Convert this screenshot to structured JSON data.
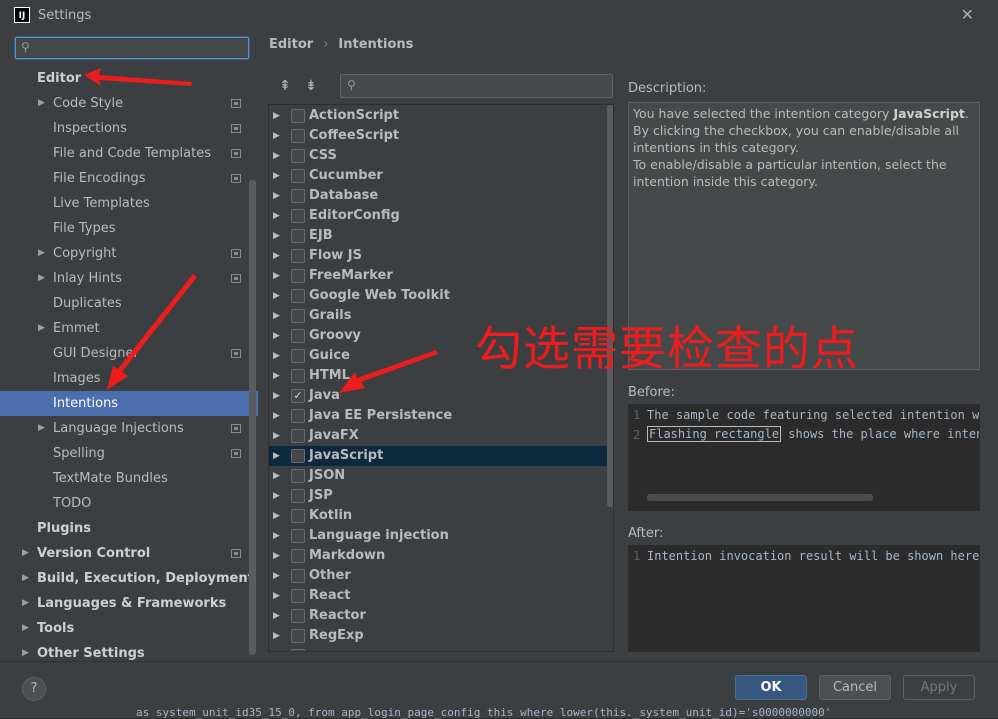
{
  "window": {
    "title": "Settings",
    "app_icon": "intellij-icon"
  },
  "sidebar": {
    "search_placeholder": "",
    "items": [
      {
        "label": "Editor",
        "level": 0,
        "bold": true,
        "arrow": false,
        "proj": false
      },
      {
        "label": "Code Style",
        "level": 1,
        "arrow": true,
        "proj": true
      },
      {
        "label": "Inspections",
        "level": 1,
        "arrow": false,
        "proj": true
      },
      {
        "label": "File and Code Templates",
        "level": 1,
        "arrow": false,
        "proj": true
      },
      {
        "label": "File Encodings",
        "level": 1,
        "arrow": false,
        "proj": true
      },
      {
        "label": "Live Templates",
        "level": 1,
        "arrow": false,
        "proj": false
      },
      {
        "label": "File Types",
        "level": 1,
        "arrow": false,
        "proj": false
      },
      {
        "label": "Copyright",
        "level": 1,
        "arrow": true,
        "proj": true
      },
      {
        "label": "Inlay Hints",
        "level": 1,
        "arrow": true,
        "proj": true
      },
      {
        "label": "Duplicates",
        "level": 1,
        "arrow": false,
        "proj": false
      },
      {
        "label": "Emmet",
        "level": 1,
        "arrow": true,
        "proj": false
      },
      {
        "label": "GUI Designer",
        "level": 1,
        "arrow": false,
        "proj": true
      },
      {
        "label": "Images",
        "level": 1,
        "arrow": false,
        "proj": false
      },
      {
        "label": "Intentions",
        "level": 1,
        "arrow": false,
        "proj": false,
        "selected": true
      },
      {
        "label": "Language Injections",
        "level": 1,
        "arrow": true,
        "proj": true
      },
      {
        "label": "Spelling",
        "level": 1,
        "arrow": false,
        "proj": true
      },
      {
        "label": "TextMate Bundles",
        "level": 1,
        "arrow": false,
        "proj": false
      },
      {
        "label": "TODO",
        "level": 1,
        "arrow": false,
        "proj": false
      },
      {
        "label": "Plugins",
        "level": 0,
        "bold": true,
        "arrow": false,
        "proj": false
      },
      {
        "label": "Version Control",
        "level": 0,
        "bold": true,
        "arrow": true,
        "proj": true
      },
      {
        "label": "Build, Execution, Deployment",
        "level": 0,
        "bold": true,
        "arrow": true,
        "proj": false
      },
      {
        "label": "Languages & Frameworks",
        "level": 0,
        "bold": true,
        "arrow": true,
        "proj": false
      },
      {
        "label": "Tools",
        "level": 0,
        "bold": true,
        "arrow": true,
        "proj": false
      },
      {
        "label": "Other Settings",
        "level": 0,
        "bold": true,
        "arrow": true,
        "proj": false
      }
    ]
  },
  "breadcrumb": {
    "parent": "Editor",
    "separator": "›",
    "current": "Intentions"
  },
  "toolbar": {
    "expand_icon": "expand-all-icon",
    "collapse_icon": "collapse-all-icon",
    "filter_placeholder": ""
  },
  "intentions": [
    {
      "label": "ActionScript",
      "checked": false
    },
    {
      "label": "CoffeeScript",
      "checked": false
    },
    {
      "label": "CSS",
      "checked": false
    },
    {
      "label": "Cucumber",
      "checked": false
    },
    {
      "label": "Database",
      "checked": false
    },
    {
      "label": "EditorConfig",
      "checked": false
    },
    {
      "label": "EJB",
      "checked": false
    },
    {
      "label": "Flow JS",
      "checked": false
    },
    {
      "label": "FreeMarker",
      "checked": false
    },
    {
      "label": "Google Web Toolkit",
      "checked": false
    },
    {
      "label": "Grails",
      "checked": false
    },
    {
      "label": "Groovy",
      "checked": false
    },
    {
      "label": "Guice",
      "checked": false
    },
    {
      "label": "HTML",
      "checked": false
    },
    {
      "label": "Java",
      "checked": true
    },
    {
      "label": "Java EE Persistence",
      "checked": false
    },
    {
      "label": "JavaFX",
      "checked": false
    },
    {
      "label": "JavaScript",
      "checked": false,
      "highlighted": true
    },
    {
      "label": "JSON",
      "checked": false
    },
    {
      "label": "JSP",
      "checked": false
    },
    {
      "label": "Kotlin",
      "checked": false
    },
    {
      "label": "Language injection",
      "checked": false
    },
    {
      "label": "Markdown",
      "checked": false
    },
    {
      "label": "Other",
      "checked": false
    },
    {
      "label": "React",
      "checked": false
    },
    {
      "label": "Reactor",
      "checked": false
    },
    {
      "label": "RegExp",
      "checked": false
    },
    {
      "label": "",
      "checked": false
    }
  ],
  "description": {
    "label": "Description:",
    "line1_prefix": "You have selected the intention category ",
    "line1_bold": "JavaScript",
    "line1_suffix": ".",
    "line2": "By clicking the checkbox, you can enable/disable all intentions in this category.",
    "line3": "To enable/disable a particular intention, select the intention inside this category."
  },
  "before": {
    "label": "Before:",
    "lines": [
      {
        "num": "1",
        "pre": "",
        "boxed": "",
        "post": "The sample code featuring selected intention will"
      },
      {
        "num": "2",
        "pre": "",
        "boxed": "Flashing rectangle",
        "post": " shows the place where intention"
      }
    ]
  },
  "after": {
    "label": "After:",
    "lines": [
      {
        "num": "1",
        "text": "Intention invocation result will be shown here."
      }
    ]
  },
  "footer": {
    "help": "?",
    "ok": "OK",
    "cancel": "Cancel",
    "apply": "Apply"
  },
  "background_code": "as system_unit_id35_15_0, from app_login_page_config this  where lower(this._system_unit_id)='s0000000000'",
  "annotation": {
    "text": "勾选需要检查的点",
    "color": "#ee1c1c"
  },
  "colors": {
    "selection": "#4b6eaf",
    "ok_button": "#365880",
    "highlight_row": "#0d293e"
  }
}
